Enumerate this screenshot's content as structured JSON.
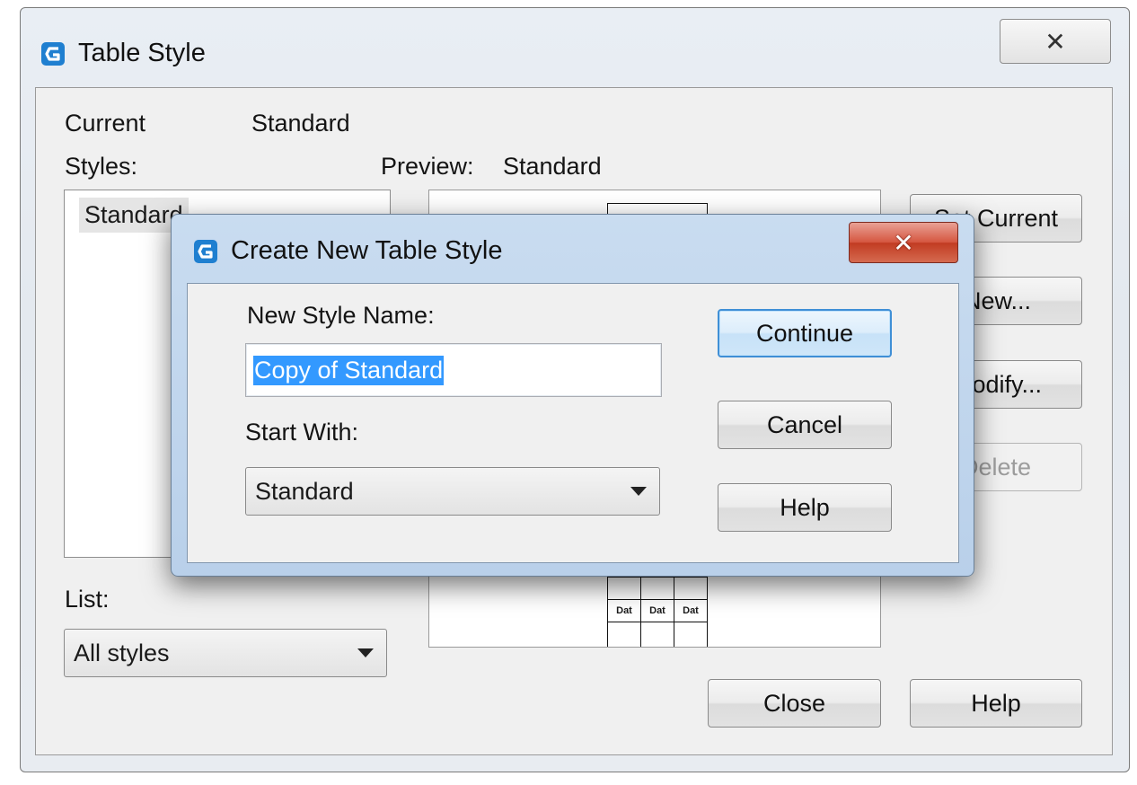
{
  "outer": {
    "title": "Table Style",
    "close_glyph": "✕",
    "current_label": "Current",
    "current_value": "Standard",
    "styles_label": "Styles:",
    "preview_label": "Preview:",
    "preview_value": "Standard",
    "styles_list": [
      "Standard"
    ],
    "buttons": {
      "set_current": "Set Current",
      "new": "New...",
      "modify": "Modify...",
      "delete": "Delete",
      "close": "Close",
      "help": "Help"
    },
    "list_label": "List:",
    "list_value": "All styles",
    "preview_cells": [
      "Dat",
      "Dat",
      "Dat"
    ]
  },
  "dialog": {
    "title": "Create New Table Style",
    "close_glyph": "✕",
    "name_label": "New Style Name:",
    "name_value": "Copy of Standard",
    "start_label": "Start With:",
    "start_value": "Standard",
    "buttons": {
      "continue": "Continue",
      "cancel": "Cancel",
      "help": "Help"
    }
  },
  "colors": {
    "accent": "#3399ff",
    "dialog_close": "#c13b22",
    "app_icon": "#1f7fd0"
  },
  "icons": {
    "app": "gstarcad-app-icon",
    "close": "close-icon",
    "dropdown": "chevron-down-icon"
  }
}
